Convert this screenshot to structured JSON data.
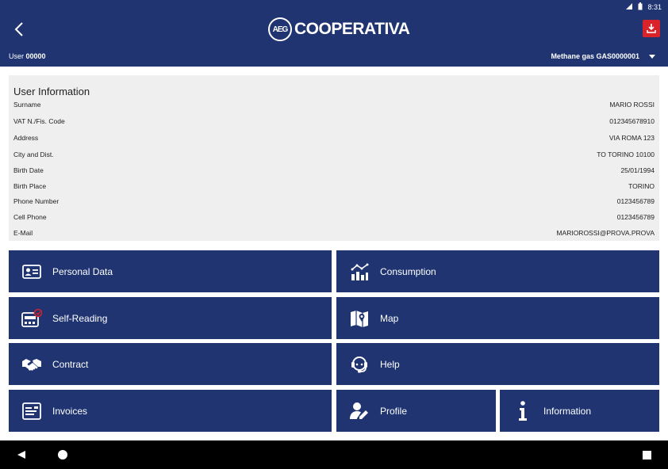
{
  "status": {
    "time": "8:31"
  },
  "header": {
    "logo_mark": "AEG",
    "logo_text": "COOPERATIVA",
    "user_label": "User",
    "user_id": "00000",
    "supply": "Methane gas GAS0000001"
  },
  "info": {
    "title": "User Information",
    "rows": [
      {
        "label": "Surname",
        "value": "MARIO ROSSI"
      },
      {
        "label": "VAT N./Fis. Code",
        "value": "012345678910"
      },
      {
        "label": "Address",
        "value": "VIA ROMA 123"
      },
      {
        "label": "City and Dist.",
        "value": "TO TORINO 10100"
      },
      {
        "label": "Birth Date",
        "value": "25/01/1994"
      },
      {
        "label": "Birth Place",
        "value": "TORINO"
      },
      {
        "label": "Phone Number",
        "value": "0123456789"
      },
      {
        "label": "Cell Phone",
        "value": "0123456789"
      },
      {
        "label": "E-Mail",
        "value": "MARIOROSSI@PROVA.PROVA"
      }
    ]
  },
  "tiles": {
    "personal_data": "Personal Data",
    "consumption": "Consumption",
    "self_reading": "Self-Reading",
    "map": "Map",
    "contract": "Contract",
    "help": "Help",
    "invoices": "Invoices",
    "profile": "Profile",
    "information": "Information"
  },
  "colors": {
    "primary": "#1f3470",
    "accent": "#d8232a",
    "panel": "#efefef"
  }
}
